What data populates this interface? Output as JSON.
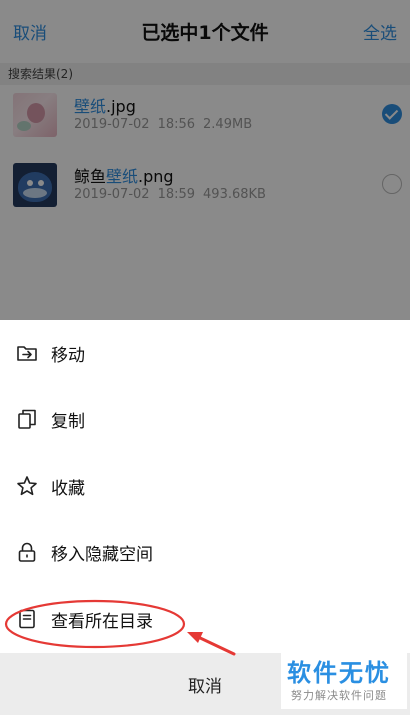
{
  "header": {
    "left": "取消",
    "title": "已选中1个文件",
    "right": "全选"
  },
  "section_label": "搜索结果(2)",
  "files": [
    {
      "name_highlight": "壁纸",
      "name_suffix": ".jpg",
      "date": "2019-07-02",
      "time": "18:56",
      "size": "2.49MB",
      "selected": true
    },
    {
      "name_prefix": "鲸鱼",
      "name_highlight": "壁纸",
      "name_suffix": ".png",
      "date": "2019-07-02",
      "time": "18:59",
      "size": "493.68KB",
      "selected": false
    }
  ],
  "actions": [
    {
      "label": "移动",
      "icon": "move-to-folder-icon"
    },
    {
      "label": "复制",
      "icon": "copy-icon"
    },
    {
      "label": "收藏",
      "icon": "star-icon"
    },
    {
      "label": "移入隐藏空间",
      "icon": "lock-icon"
    },
    {
      "label": "查看所在目录",
      "icon": "document-icon"
    }
  ],
  "cancel_label": "取消",
  "watermark": {
    "title": "软件无忧",
    "subtitle": "努力解决软件问题"
  },
  "colors": {
    "accent": "#2f8ee0",
    "annotation": "#e53935",
    "watermark": "#2a8fe2"
  }
}
